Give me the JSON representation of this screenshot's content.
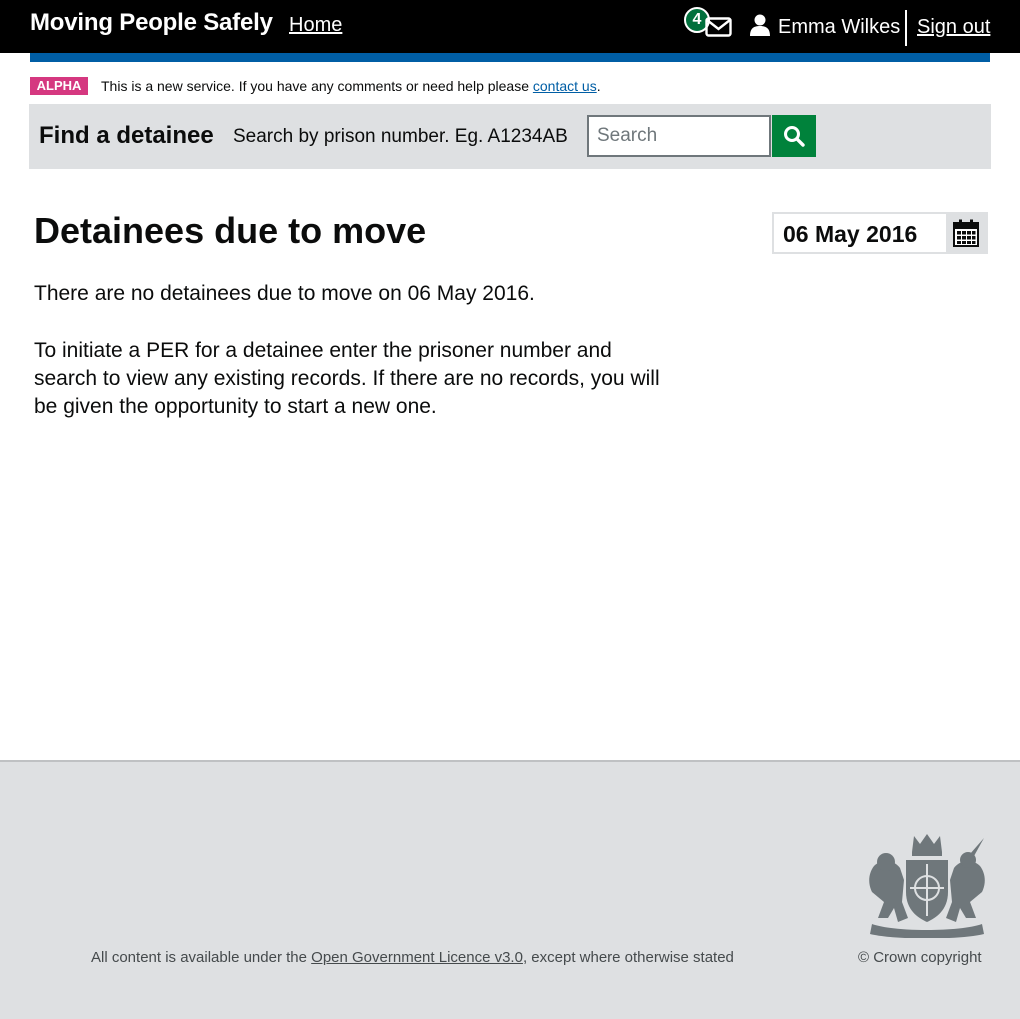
{
  "header": {
    "brand": "Moving People Safely",
    "home_link": "Home",
    "notification_count": "4",
    "user_name": "Emma Wilkes",
    "sign_out": "Sign out",
    "icons": [
      "envelope-icon",
      "user-icon"
    ]
  },
  "phase_banner": {
    "tag": "ALPHA",
    "text": "This is a new service. If you have any comments or need help please",
    "link": "contact us",
    "suffix": "."
  },
  "search": {
    "title": "Find a detainee",
    "hint": "Search by prison number. Eg. A1234AB",
    "placeholder": "Search",
    "button_icon": "search-icon"
  },
  "main": {
    "title": "Detainees due to move",
    "date": "06 May 2016",
    "calendar_icon": "calendar-icon",
    "no_results": "There are no detainees due to move on 06 May 2016.",
    "instructions": "To initiate a PER for a detainee enter the prisoner number and search to view any existing records. If there are no records, you will be given the opportunity to start a new one."
  },
  "footer": {
    "licence_prefix": "All content is available under the",
    "licence_link": "Open Government Licence v3.0",
    "licence_suffix": ", except where otherwise stated",
    "copyright": "© Crown copyright"
  },
  "colors": {
    "header_bg": "#000000",
    "blue_bar": "#005ea5",
    "alpha_tag": "#d53880",
    "badge": "#00703c",
    "search_button": "#00823b",
    "panel_grey": "#dee0e2"
  }
}
